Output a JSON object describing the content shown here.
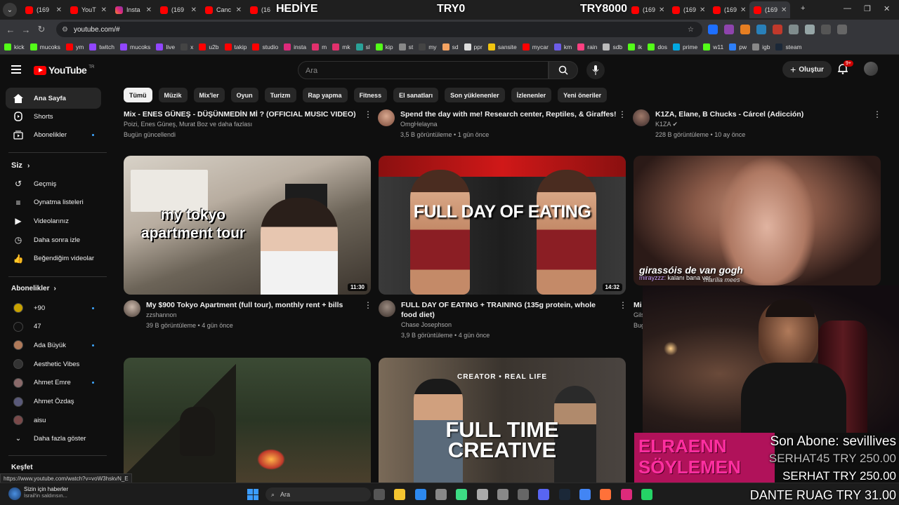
{
  "browser": {
    "tabs": [
      {
        "label": "(169",
        "kind": "yt"
      },
      {
        "label": "YouT",
        "kind": "yt"
      },
      {
        "label": "Insta",
        "kind": "ig"
      },
      {
        "label": "(169",
        "kind": "yt"
      },
      {
        "label": "Canc",
        "kind": "yt"
      },
      {
        "label": "(16",
        "kind": "yt"
      }
    ],
    "right_tabs": [
      "(169",
      "(169",
      "(169",
      "(169"
    ],
    "url": "youtube.com/#",
    "status_url": "https://www.youtube.com/watch?v=voW3hskvN_E"
  },
  "stream_overlay": {
    "hediye": "HEDİYE",
    "try0": "TRY0",
    "try8000": "TRY8000",
    "chat_name": "mirayzzz:",
    "chat_msg": "kalanı bana ver",
    "sub_line": "Son Abone: sevillives",
    "don1": "SERHAT45 TRY 250.00",
    "don2": "SERHAT  TRY 250.00",
    "don3": "DANTE RUAG  TRY 31.00",
    "banner": "ELRAENN SÖYLEMEN"
  },
  "bookmarks": [
    {
      "label": "kick",
      "color": "#53fc18"
    },
    {
      "label": "mucoks",
      "color": "#53fc18"
    },
    {
      "label": "ym",
      "color": "#ff0000"
    },
    {
      "label": "twitch",
      "color": "#9146ff"
    },
    {
      "label": "mucoks",
      "color": "#9146ff"
    },
    {
      "label": "live",
      "color": "#9146ff"
    },
    {
      "label": "x",
      "color": "#444444"
    },
    {
      "label": "u2b",
      "color": "#ff0000"
    },
    {
      "label": "takip",
      "color": "#ff0000"
    },
    {
      "label": "studio",
      "color": "#ff0000"
    },
    {
      "label": "insta",
      "color": "#dd2a7b"
    },
    {
      "label": "m",
      "color": "#e1306c"
    },
    {
      "label": "mk",
      "color": "#e1306c"
    },
    {
      "label": "sl",
      "color": "#2aa198"
    },
    {
      "label": "kip",
      "color": "#53fc18"
    },
    {
      "label": "st",
      "color": "#888888"
    },
    {
      "label": "my",
      "color": "#444444"
    },
    {
      "label": "sd",
      "color": "#f4a261"
    },
    {
      "label": "ppr",
      "color": "#dddddd"
    },
    {
      "label": "sansite",
      "color": "#f1c40f"
    },
    {
      "label": "mycar",
      "color": "#ff0000"
    },
    {
      "label": "km",
      "color": "#6c5ce7"
    },
    {
      "label": "rain",
      "color": "#ff4081"
    },
    {
      "label": "sdb",
      "color": "#bbbbbb"
    },
    {
      "label": "ik",
      "color": "#53fc18"
    },
    {
      "label": "dos",
      "color": "#53fc18"
    },
    {
      "label": "prime",
      "color": "#00a8e1"
    },
    {
      "label": "w11",
      "color": "#53fc18"
    },
    {
      "label": "pw",
      "color": "#2d7ff9"
    },
    {
      "label": "igb",
      "color": "#888888"
    },
    {
      "label": "steam",
      "color": "#1b2838"
    }
  ],
  "header": {
    "logo": "YouTube",
    "region": "TR",
    "search_placeholder": "Ara",
    "create_label": "Oluştur",
    "notif_count": "9+"
  },
  "sidebar": {
    "main": [
      "Ana Sayfa",
      "Shorts",
      "Abonelikler"
    ],
    "you_title": "Siz",
    "you_items": [
      "Geçmiş",
      "Oynatma listeleri",
      "Videolarınız",
      "Daha sonra izle",
      "Beğendiğim videolar"
    ],
    "subs_title": "Abonelikler",
    "subs": [
      {
        "name": "+90",
        "color": "#c8a200"
      },
      {
        "name": "47",
        "color": "#111111"
      },
      {
        "name": "Ada Büyük",
        "color": "#b07a5a"
      },
      {
        "name": "Aesthetic Vibes",
        "color": "#333333"
      },
      {
        "name": "Ahmet Emre",
        "color": "#8a6a6a"
      },
      {
        "name": "Ahmet Özdaş",
        "color": "#5a5a7a"
      },
      {
        "name": "aisu",
        "color": "#7a4a4a"
      }
    ],
    "more": "Daha fazla göster",
    "explore": "Keşfet"
  },
  "chips": [
    "Tümü",
    "Müzik",
    "Mix'ler",
    "Oyun",
    "Turizm",
    "Rap yapma",
    "Fitness",
    "El sanatları",
    "Son yüklenenler",
    "İzlenenler",
    "Yeni öneriler"
  ],
  "top_row": [
    {
      "title": "Mix - ENES GÜNEŞ - DÜŞÜNMEDİN Mİ ? (OFFICIAL MUSIC VIDEO)",
      "line1": "Poizi, Enes Güneş, Murat Boz ve daha fazlası",
      "line2": "Bugün güncellendi"
    },
    {
      "title": "Spend the day with me! Research center, Reptiles, & Giraffes!",
      "line1": "OmgHelayna",
      "line2": "3,5 B görüntüleme • 1 gün önce"
    },
    {
      "title": "K1ZA, Elane, B Chucks - Cárcel (Adicción)",
      "line1": "K1ZA",
      "line2": "228 B görüntüleme • 10 ay önce"
    }
  ],
  "mid_row": [
    {
      "thumb_text": "my tokyo apartment tour",
      "duration": "11:30",
      "title": "My $900 Tokyo Apartment (full tour), monthly rent + bills",
      "channel": "zzshannon",
      "stats": "39 B görüntüleme • 4 gün önce"
    },
    {
      "thumb_text": "FULL DAY OF EATING",
      "duration": "14:32",
      "title": "FULL DAY OF EATING + TRAINING (135g protein, whole food diet)",
      "channel": "Chase Josephson",
      "stats": "3,9 B görüntüleme • 4 gün önce"
    },
    {
      "thumb_text": "girassóis de van gogh",
      "thumb_sub": "marília mees",
      "title": "Mi",
      "channel": "Gils",
      "stats": "Bug"
    }
  ],
  "bottom_row": [
    {
      "thumb_text": ""
    },
    {
      "thumb_top": "CREATOR • REAL LIFE",
      "thumb_text": "FULL TIME CREATIVE"
    }
  ],
  "taskbar": {
    "news_title": "Sizin için haberler",
    "news_sub": "İsrail'in saldırısın...",
    "search": "Ara"
  }
}
